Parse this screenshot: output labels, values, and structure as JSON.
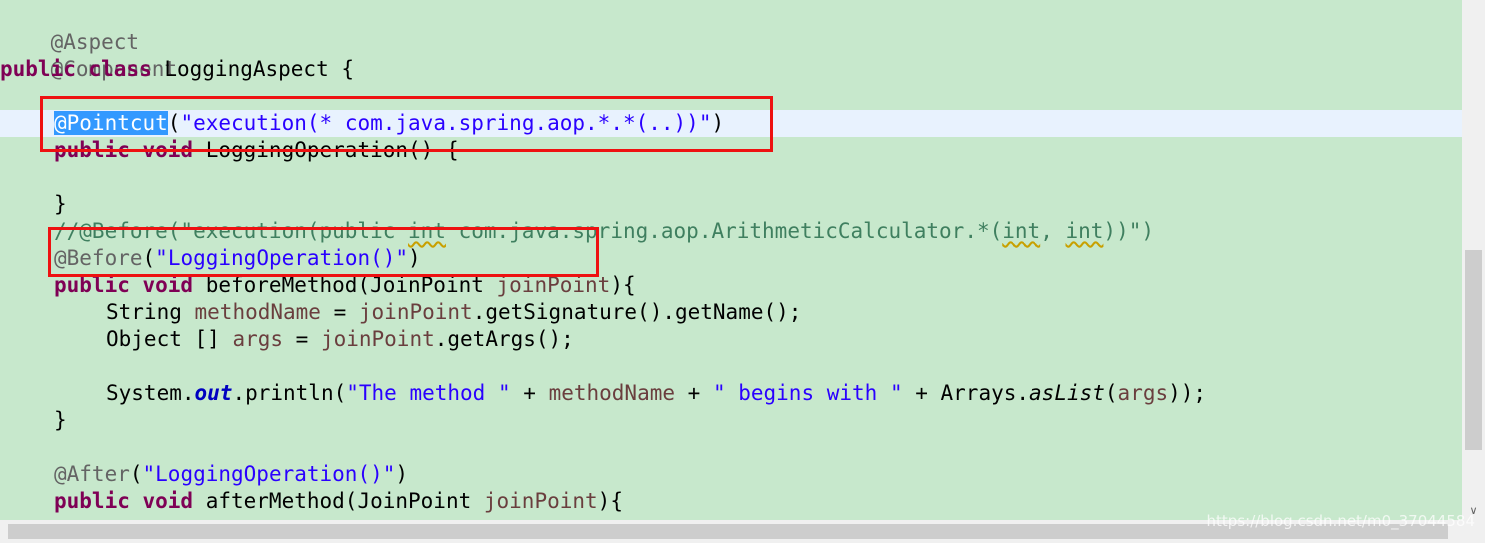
{
  "code": {
    "l0": "@Aspect",
    "l1": "@Component",
    "l2_kw": "public class",
    "l2_rest": " LoggingAspect {",
    "l4_ann": "@Pointcut",
    "l4_open": "(",
    "l4_str": "\"execution(* com.java.spring.aop.*.*(..))\"",
    "l4_close": ")",
    "l5_kw": "public void",
    "l5_rest": " LoggingOperation() {",
    "l7": "}",
    "l8_a": "//@Before(\"execution(public ",
    "l8_int1": "int",
    "l8_b": " com.java.spring.aop.ArithmeticCalculator.*(",
    "l8_int2": "int",
    "l8_c": ", ",
    "l8_int3": "int",
    "l8_d": "))\")",
    "l9_ann": "@Before",
    "l9_open": "(",
    "l9_str": "\"LoggingOperation()\"",
    "l9_close": ")",
    "l10_kw": "public void",
    "l10_a": " beforeMethod(JoinPoint ",
    "l10_var": "joinPoint",
    "l10_b": "){",
    "l11_a": "String ",
    "l11_var1": "methodName",
    "l11_b": " = ",
    "l11_var2": "joinPoint",
    "l11_c": ".getSignature().getName();",
    "l12_a": "Object [] ",
    "l12_var1": "args",
    "l12_b": " = ",
    "l12_var2": "joinPoint",
    "l12_c": ".getArgs();",
    "l14_a": "System.",
    "l14_fld": "out",
    "l14_b": ".println(",
    "l14_str1": "\"The method \"",
    "l14_c": " + ",
    "l14_var1": "methodName",
    "l14_d": " + ",
    "l14_str2": "\" begins with \"",
    "l14_e": " + Arrays.",
    "l14_ital": "asList",
    "l14_f": "(",
    "l14_var2": "args",
    "l14_g": "));",
    "l15": "}",
    "l17_ann": "@After",
    "l17_open": "(",
    "l17_str": "\"LoggingOperation()\"",
    "l17_close": ")",
    "l18_kw": "public void",
    "l18_a": " afterMethod(JoinPoint ",
    "l18_var": "joinPoint",
    "l18_b": "){"
  },
  "watermark": "https://blog.csdn.net/m0_37044584",
  "scrollbar": {
    "down_arrow": "∨"
  },
  "colors": {
    "background": "#c7e8cc",
    "current_line": "#e8f2fe",
    "keyword": "#7f0055",
    "string": "#2a00ff",
    "annotation": "#646464",
    "highlight_box": "#ee1111"
  }
}
